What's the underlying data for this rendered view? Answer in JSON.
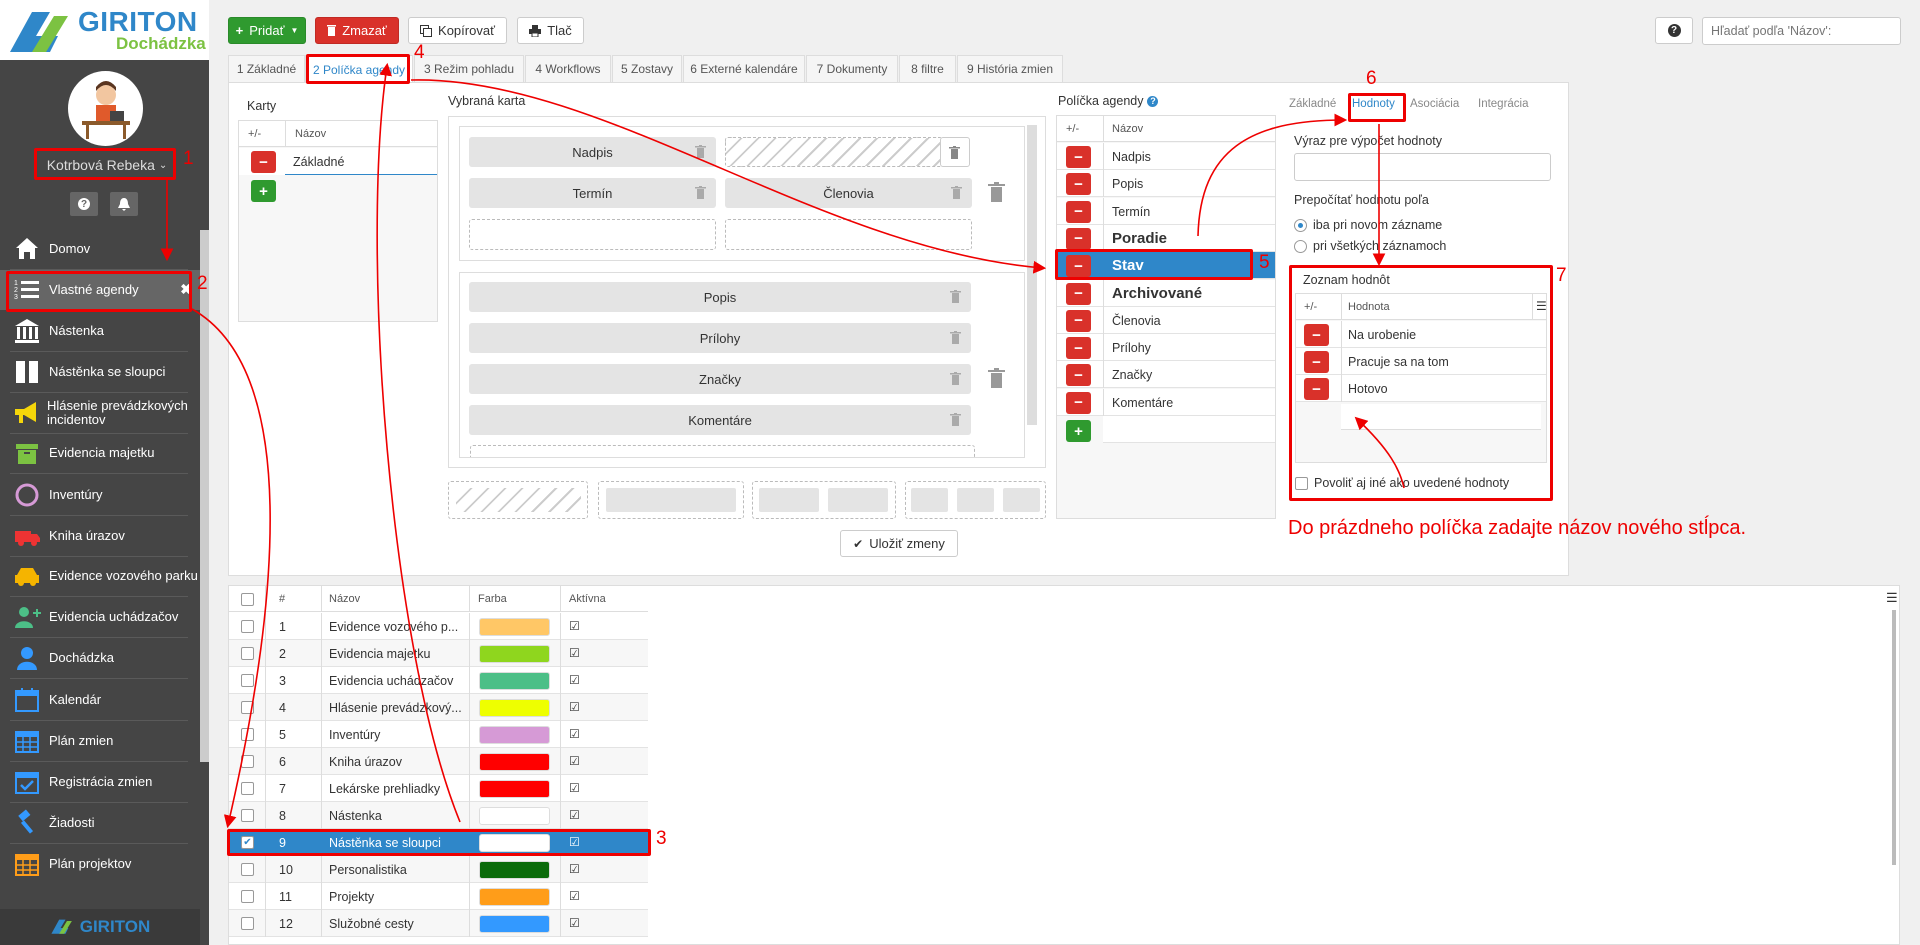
{
  "brand": {
    "name": "GIRITON",
    "subtitle": "Dochádzka",
    "footer_name": "GIRITON"
  },
  "user": {
    "name": "Kotrbová Rebeka"
  },
  "sidebar": {
    "items": [
      {
        "label": "Domov",
        "icon": "home-icon"
      },
      {
        "label": "Vlastné agendy",
        "icon": "list-numbered-icon",
        "active": true
      },
      {
        "label": "Nástenka",
        "icon": "bank-icon"
      },
      {
        "label": "Nástěnka se sloupci",
        "icon": "columns-icon"
      },
      {
        "label": "Hlásenie prevádzkových incidentov",
        "icon": "megaphone-icon"
      },
      {
        "label": "Evidencia majetku",
        "icon": "box-icon"
      },
      {
        "label": "Inventúry",
        "icon": "circle-icon"
      },
      {
        "label": "Kniha úrazov",
        "icon": "ambulance-icon"
      },
      {
        "label": "Evidence vozového parku",
        "icon": "car-icon"
      },
      {
        "label": "Evidencia uchádzačov",
        "icon": "add-user-icon"
      },
      {
        "label": "Dochádzka",
        "icon": "user-icon"
      },
      {
        "label": "Kalendár",
        "icon": "calendar-icon"
      },
      {
        "label": "Plán zmien",
        "icon": "calendar-grid-icon"
      },
      {
        "label": "Registrácia zmien",
        "icon": "calendar-check-icon"
      },
      {
        "label": "Žiadosti",
        "icon": "gavel-icon"
      },
      {
        "label": "Plán projektov",
        "icon": "calendar-grid-icon"
      }
    ]
  },
  "toolbar": {
    "add": "Pridať",
    "delete": "Zmazať",
    "copy": "Kopírovať",
    "print": "Tlač"
  },
  "search": {
    "placeholder": "Hľadať podľa 'Názov':"
  },
  "tabs": [
    "1 Základné",
    "2 Políčka agendy",
    "3 Režim pohladu",
    "4 Workflows",
    "5 Zostavy",
    "6 Externé kalendáre",
    "7 Dokumenty",
    "8 filtre",
    "9 História zmien"
  ],
  "cards": {
    "title": "Karty",
    "col_pm": "+/-",
    "col_name": "Názov",
    "rows": [
      "Základné"
    ]
  },
  "selected_card": {
    "title": "Vybraná karta",
    "group1": [
      "Nadpis",
      "Termín",
      "Členovia"
    ],
    "group2": [
      "Popis",
      "Prílohy",
      "Značky",
      "Komentáre"
    ]
  },
  "fields": {
    "title": "Políčka agendy",
    "col_pm": "+/-",
    "col_name": "Názov",
    "rows": [
      {
        "name": "Nadpis"
      },
      {
        "name": "Popis"
      },
      {
        "name": "Termín"
      },
      {
        "name": "Poradie",
        "bold": true
      },
      {
        "name": "Stav",
        "bold": true,
        "selected": true
      },
      {
        "name": "Archivované",
        "bold": true
      },
      {
        "name": "Členovia"
      },
      {
        "name": "Prílohy"
      },
      {
        "name": "Značky"
      },
      {
        "name": "Komentáre"
      }
    ]
  },
  "save_button": "Uložiť zmeny",
  "props": {
    "tabs": [
      "Základné",
      "Hodnoty",
      "Asociácia",
      "Integrácia"
    ],
    "expr_label": "Výraz pre výpočet hodnoty",
    "recalc_label": "Prepočítať hodnotu poľa",
    "radio1": "iba pri novom zázname",
    "radio2": "pri všetkých záznamoch",
    "values_title": "Zoznam hodnôt",
    "col_pm": "+/-",
    "col_value": "Hodnota",
    "values": [
      "Na urobenie",
      "Pracuje sa na tom",
      "Hotovo"
    ],
    "allow_other": "Povoliť aj iné ako uvedené hodnoty"
  },
  "note": "Do prázdneho políčka zadajte názov nového stĺpca.",
  "callouts": [
    "1",
    "2",
    "3",
    "4",
    "5",
    "6",
    "7"
  ],
  "grid": {
    "headers": [
      "#",
      "Názov",
      "Farba",
      "Aktívna"
    ],
    "rows": [
      {
        "n": "1",
        "name": "Evidence vozového p...",
        "color": "#ffc766"
      },
      {
        "n": "2",
        "name": "Evidencia majetku",
        "color": "#8fd61e"
      },
      {
        "n": "3",
        "name": "Evidencia uchádzačov",
        "color": "#4cbf87"
      },
      {
        "n": "4",
        "name": "Hlásenie prevádzkový...",
        "color": "#eeff00"
      },
      {
        "n": "5",
        "name": "Inventúry",
        "color": "#d69ad6"
      },
      {
        "n": "6",
        "name": "Kniha úrazov",
        "color": "#ff0000"
      },
      {
        "n": "7",
        "name": "Lekárske prehliadky",
        "color": "#ff0000"
      },
      {
        "n": "8",
        "name": "Nástenka",
        "color": "#ffffff"
      },
      {
        "n": "9",
        "name": "Nástěnka se sloupci",
        "color": "#ffffff",
        "selected": true
      },
      {
        "n": "10",
        "name": "Personalistika",
        "color": "#0b6b0b"
      },
      {
        "n": "11",
        "name": "Projekty",
        "color": "#ff9d19"
      },
      {
        "n": "12",
        "name": "Služobné cesty",
        "color": "#3399ff"
      }
    ]
  }
}
